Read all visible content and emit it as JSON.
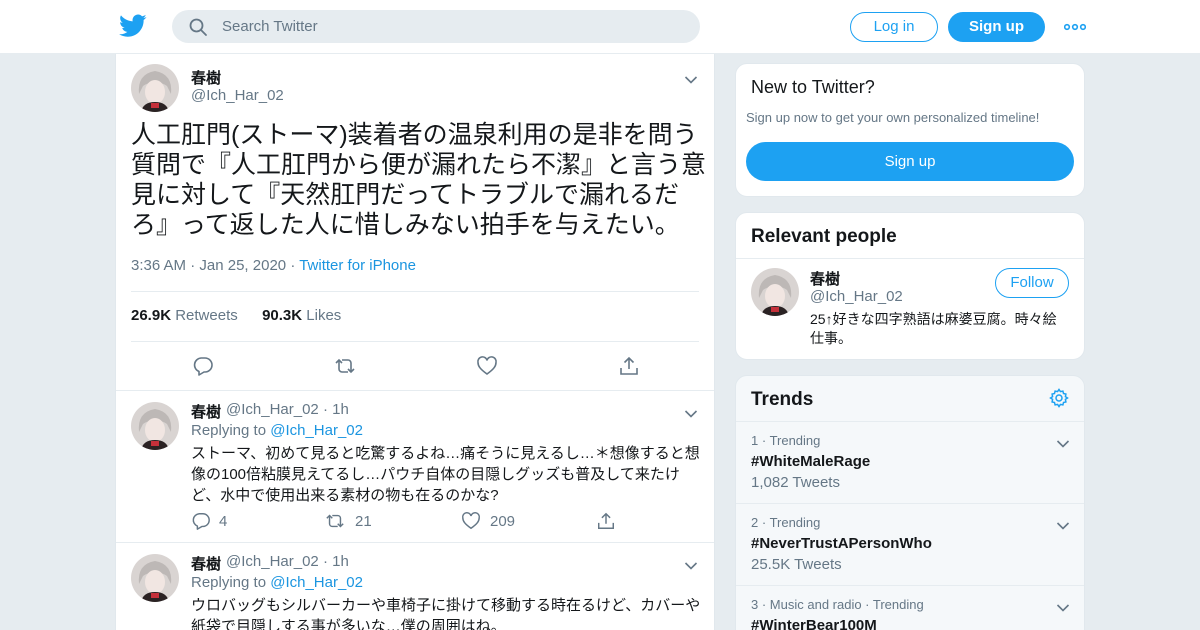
{
  "header": {
    "search_placeholder": "Search Twitter",
    "login_label": "Log in",
    "signup_label": "Sign up"
  },
  "main_tweet": {
    "name": "春樹",
    "handle": "@Ich_Har_02",
    "text": "人工肛門(ストーマ)装着者の温泉利用の是非を問う質問で『人工肛門から便が漏れたら不潔』と言う意見に対して『天然肛門だってトラブルで漏れるだろ』って返した人に惜しみない拍手を与えたい。",
    "time": "3:36 AM",
    "date": "Jan 25, 2020",
    "source": "Twitter for iPhone",
    "retweets_count": "26.9K",
    "retweets_label": "Retweets",
    "likes_count": "90.3K",
    "likes_label": "Likes"
  },
  "replies": [
    {
      "name": "春樹",
      "handle": "@Ich_Har_02",
      "age": "1h",
      "replying_label": "Replying to",
      "replying_handle": "@Ich_Har_02",
      "text": "ストーマ、初めて見ると吃驚するよね…痛そうに見えるし…＊想像すると想像の100倍粘膜見えてるし…パウチ自体の目隠しグッズも普及して来たけど、水中で使用出来る素材の物も在るのかな?",
      "reply_count": "4",
      "retweet_count": "21",
      "like_count": "209"
    },
    {
      "name": "春樹",
      "handle": "@Ich_Har_02",
      "age": "1h",
      "replying_label": "Replying to",
      "replying_handle": "@Ich_Har_02",
      "text": "ウロバッグもシルバーカーや車椅子に掛けて移動する時在るけど、カバーや紙袋で目隠しする事が多いな…僕の周囲はね。"
    }
  ],
  "new_to_twitter": {
    "title": "New to Twitter?",
    "subtitle": "Sign up now to get your own personalized timeline!",
    "signup_label": "Sign up"
  },
  "relevant_people": {
    "title": "Relevant people",
    "name": "春樹",
    "handle": "@Ich_Har_02",
    "follow_label": "Follow",
    "bio": "25↑好きな四字熟語は麻婆豆腐。時々絵仕事。"
  },
  "trends": {
    "title": "Trends",
    "items": [
      {
        "rank": "1",
        "context": "Trending",
        "name": "#WhiteMaleRage",
        "count": "1,082 Tweets"
      },
      {
        "rank": "2",
        "context": "Trending",
        "name": "#NeverTrustAPersonWho",
        "count": "25.5K Tweets"
      },
      {
        "rank": "3",
        "context": "Music and radio · Trending",
        "name": "#WinterBear100M",
        "count": ""
      }
    ]
  },
  "colors": {
    "accent": "#1da1f2",
    "link": "#1b95e0",
    "background": "#e6ecf0",
    "muted": "#657786",
    "text": "#14171a"
  },
  "icons": [
    "twitter-bird-icon",
    "search-icon",
    "more-icon",
    "chevron-down-icon",
    "reply-icon",
    "retweet-icon",
    "like-icon",
    "share-icon",
    "settings-gear-icon"
  ]
}
